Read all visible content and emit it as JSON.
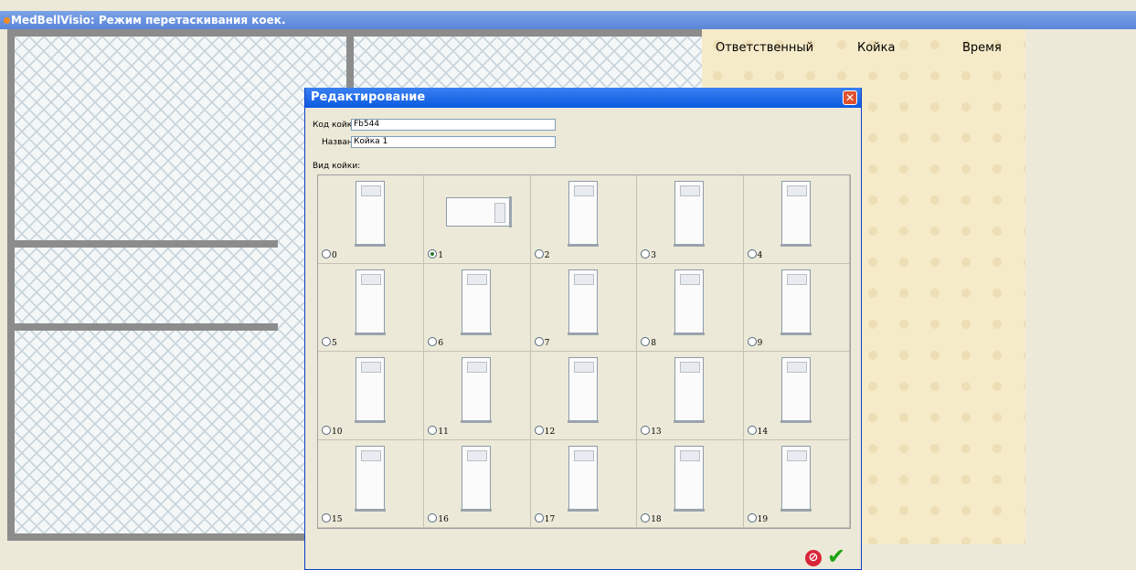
{
  "app": {
    "title": "MedBellVisio: Режим перетаскивания коек."
  },
  "panel": {
    "columns": [
      "Ответственный",
      "Койка",
      "Время"
    ]
  },
  "dialog": {
    "title": "Редактирование",
    "bed_code_label": "Код койки:",
    "bed_code_value": "Fb544",
    "name_label": "Название:",
    "name_value": "Койка 1",
    "bed_type_label": "Вид койки:",
    "selected_option": "1",
    "options": [
      "0",
      "1",
      "2",
      "3",
      "4",
      "5",
      "6",
      "7",
      "8",
      "9",
      "10",
      "11",
      "12",
      "13",
      "14",
      "15",
      "16",
      "17",
      "18",
      "19"
    ]
  },
  "icons": {
    "close": "close-icon",
    "cancel": "cancel-icon",
    "ok": "check-icon"
  },
  "colors": {
    "title_bar": "#7aa2e6",
    "dialog_title": "#0c5ae0",
    "panel": "#f6ebc9",
    "ok": "#1da30f",
    "cancel": "#d9263a"
  }
}
